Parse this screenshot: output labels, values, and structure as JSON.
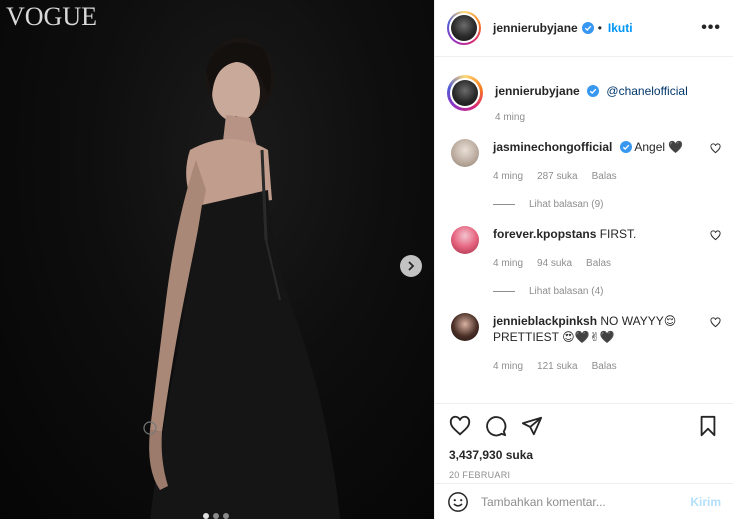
{
  "post": {
    "watermark": "VOGUE",
    "carousel": {
      "count": 3,
      "active": 0
    }
  },
  "header": {
    "username": "jennierubyjane",
    "separator": "•",
    "follow_label": "Ikuti",
    "more_label": "•••"
  },
  "caption": {
    "username": "jennierubyjane",
    "mention": "@chanelofficial",
    "time": "4 ming"
  },
  "comments": [
    {
      "username": "jasminechongofficial",
      "text": "Angel 🖤",
      "time": "4 ming",
      "likes": "287 suka",
      "reply_label": "Balas",
      "view_replies": "Lihat balasan (9)"
    },
    {
      "username": "forever.kpopstans",
      "text": "FIRST.",
      "time": "4 ming",
      "likes": "94 suka",
      "reply_label": "Balas",
      "view_replies": "Lihat balasan (4)"
    },
    {
      "username": "jennieblackpinksh",
      "text": "NO WAYYY😌 PRETTIEST 😍🖤✌🖤",
      "time": "4 ming",
      "likes": "121 suka",
      "reply_label": "Balas"
    }
  ],
  "stats": {
    "likes": "3,437,930 suka",
    "date": "20 FEBRUARI"
  },
  "composer": {
    "placeholder": "Tambahkan komentar...",
    "send_label": "Kirim"
  },
  "colors": {
    "accent": "#0095f6",
    "send_disabled": "#b2dffc",
    "muted": "#8e8e8e"
  }
}
